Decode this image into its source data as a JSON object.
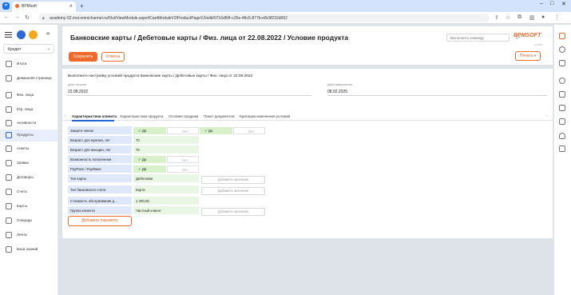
{
  "browser": {
    "tab_title": "BPMsoft",
    "url": "academy-02.mst.omnichannel.ru/0/ui/ViewModule.aspx#CardModuleV2/ProductPageV2/edit/0716d5f4-c26e-48c5-877b-e8c9f232d062"
  },
  "sidebar": {
    "dropdown_value": "Кредит",
    "items": [
      {
        "label": "Итоги"
      },
      {
        "label": "Домашняя страница"
      },
      {
        "label": "Физ. лица"
      },
      {
        "label": "Юр. лица"
      },
      {
        "label": "Активности"
      },
      {
        "label": "Продукты"
      },
      {
        "label": "Анкеты"
      },
      {
        "label": "Заявки"
      },
      {
        "label": "Договоры"
      },
      {
        "label": "Счета"
      },
      {
        "label": "Карты"
      },
      {
        "label": "Очереди"
      },
      {
        "label": "Лента"
      },
      {
        "label": "База знаний"
      }
    ]
  },
  "header": {
    "title": "Банковские карты / Дебетовые карты / Физ. лица от 22.08.2022 / Условие продукта",
    "command_placeholder": "Выполнить команду",
    "logo": "BPMSOFT",
    "logo_sub": "CLOUD",
    "save_label": "Сохранить",
    "cancel_label": "Отмена",
    "print_label": "Печать"
  },
  "form": {
    "info_text": "Выполните настройку условий продукта Банковские карты / Дебетовые карты / Физ. лица от 22.08.2022",
    "start_label": "Дата начала*",
    "start_value": "22.08.2022",
    "end_label": "Дата завершения",
    "end_value": "08.02.2025"
  },
  "tabs": [
    "Характеристики клиента",
    "Характеристики продукта",
    "Условия продажи",
    "Пакет документов",
    "Критерии изменения условий"
  ],
  "grid": {
    "rows": [
      {
        "label": "Защита чином",
        "yes": "Да",
        "no": "Нет",
        "yes2": "Да",
        "no2": "Нет"
      },
      {
        "label": "Возраст для мужчин, лет",
        "value": "70"
      },
      {
        "label": "Возраст для женщин, лет",
        "value": "70"
      },
      {
        "label": "Возможность пополнения",
        "yes": "Да",
        "no": "Нет"
      },
      {
        "label": "PayPass / PayWave",
        "yes": "Да",
        "no": "Нет"
      },
      {
        "label": "Тип карты",
        "value": "Дебетовая",
        "add": "Добавить значение"
      },
      {
        "label": "Тип банковского счета",
        "value": "Карта",
        "add": "Добавить значение"
      },
      {
        "label": "Стоимость обслуживания д...",
        "value": "1 200,00"
      },
      {
        "label": "Группа клиента",
        "value": "Частный клиент",
        "add": "Добавить значение"
      }
    ],
    "add_param_label": "Добавить параметр"
  }
}
